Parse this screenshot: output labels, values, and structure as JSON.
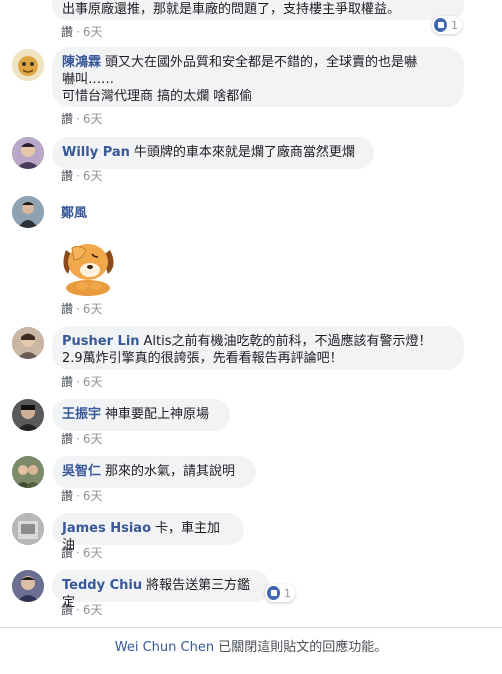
{
  "comments": [
    {
      "name": "",
      "lines": [
        "出事原廠還推，那就是車廠的問題了，支持樓主爭取權益。"
      ],
      "like": "讚",
      "time": "6天",
      "reaction_count": "1",
      "reaction_icon": "like-icon"
    },
    {
      "name": "陳鴻霖",
      "lines": [
        "頭又大在國外品質和安全都是不錯的，全球賣的也是嚇",
        "嚇叫……",
        "可惜台灣代理商 搞的太爛 啥都偷"
      ],
      "like": "讚",
      "time": "6天"
    },
    {
      "name": "Willy Pan",
      "lines": [
        "牛頭牌的車本來就是爛了廠商當然更爛"
      ],
      "like": "讚",
      "time": "6天"
    },
    {
      "name": "鄭風",
      "lines": [],
      "like": "讚",
      "time": "6天",
      "sticker": "puppy-facepalm-sticker"
    },
    {
      "name": "Pusher Lin",
      "lines": [
        "Altis之前有機油吃乾的前科，不過應該有警示燈！",
        "2.9萬炸引擎真的很誇張，先看看報告再評論吧！"
      ],
      "like": "讚",
      "time": "6天"
    },
    {
      "name": "王振宇",
      "lines": [
        "神車要配上神原場"
      ],
      "like": "讚",
      "time": "6天"
    },
    {
      "name": "吳智仁",
      "lines": [
        "那來的水氣，請其說明"
      ],
      "like": "讚",
      "time": "6天"
    },
    {
      "name": "James Hsiao",
      "lines": [
        "卡，車主加油"
      ],
      "like": "讚",
      "time": "6天"
    },
    {
      "name": "Teddy Chiu",
      "lines": [
        "將報告送第三方鑑定"
      ],
      "like": "讚",
      "time": "6天",
      "reaction_count": "1",
      "reaction_icon": "like-icon"
    }
  ],
  "meta_separator": "·",
  "footer": {
    "name": "Wei Chun Chen",
    "text": "已關閉這則貼文的回應功能。"
  },
  "colors": {
    "link": "#385898",
    "bubble": "#f2f3f5",
    "meta": "#90949c",
    "like_blue": "#4267b2"
  }
}
